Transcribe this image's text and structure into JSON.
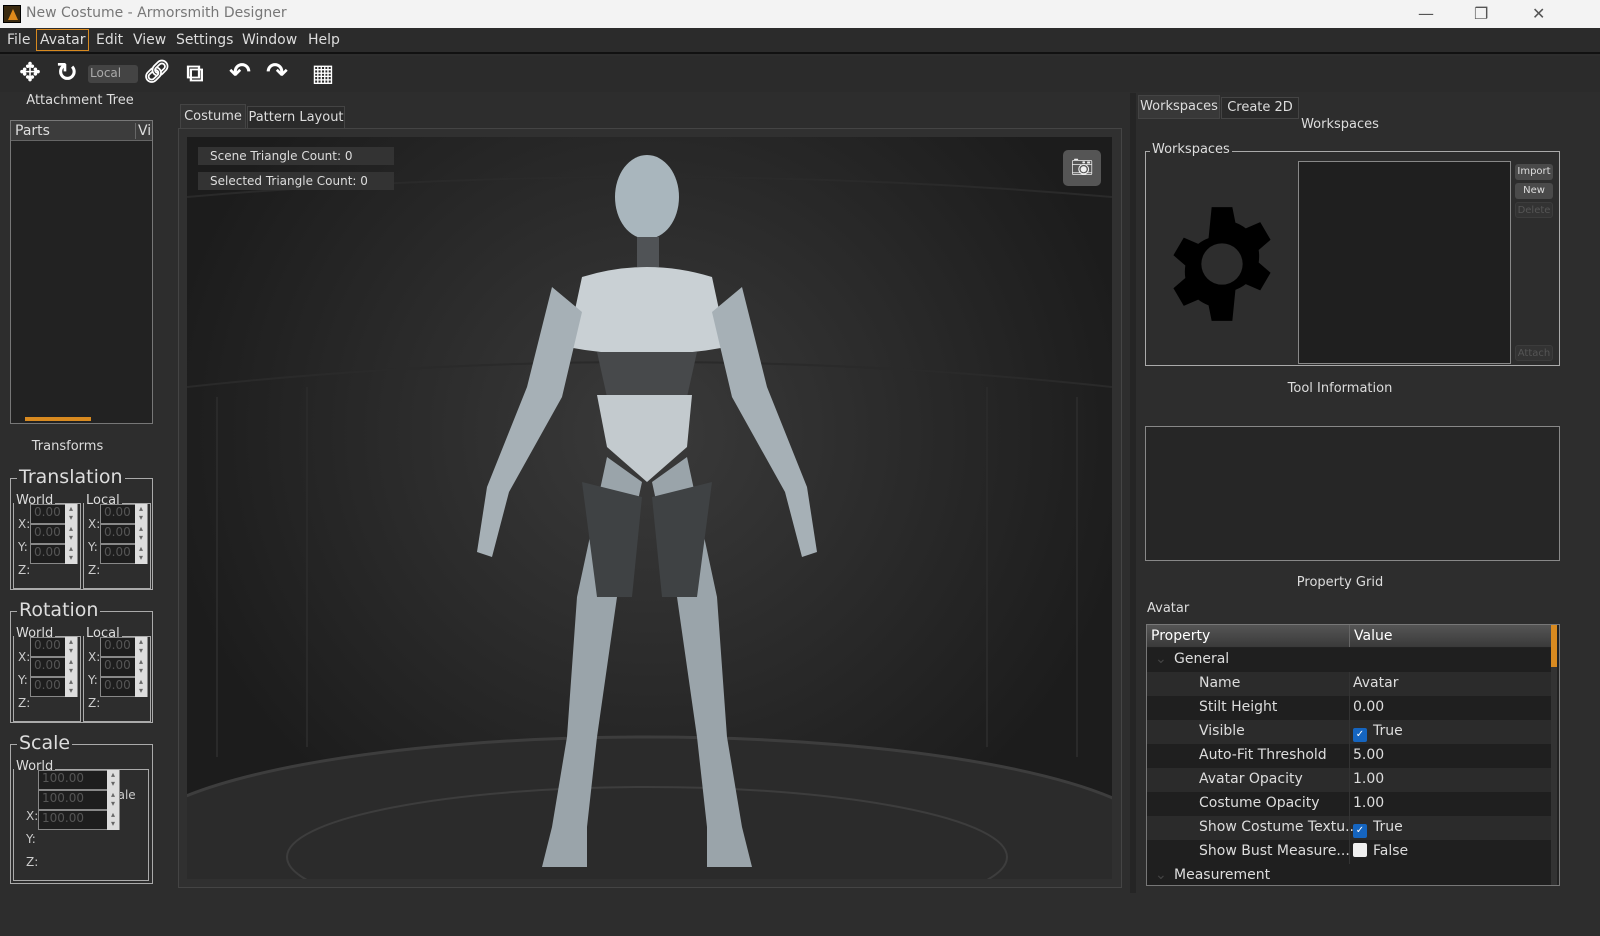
{
  "window": {
    "title": "New Costume - Armorsmith Designer"
  },
  "menu": [
    "File",
    "Avatar",
    "Edit",
    "View",
    "Settings",
    "Window",
    "Help"
  ],
  "toolbar": {
    "space_select": "Local"
  },
  "attachment_tree": {
    "title": "Attachment Tree",
    "columns": [
      "Parts",
      "Vi"
    ]
  },
  "transforms": {
    "title": "Transforms",
    "translation": "Translation",
    "rotation": "Rotation",
    "scale": "Scale",
    "world": "World",
    "local": "Local",
    "x": "X:",
    "y": "Y:",
    "z": "Z:",
    "zero": "0.00",
    "hundred": "100.00",
    "uniform_scale": "Uniform Scale"
  },
  "center_tabs": [
    "Costume",
    "Pattern Layout"
  ],
  "viewport": {
    "scene_tri": "Scene Triangle Count: 0",
    "selected_tri": "Selected Triangle Count: 0"
  },
  "right_tabs": [
    "Workspaces",
    "Create 2D"
  ],
  "workspaces": {
    "title": "Workspaces",
    "group": "Workspaces",
    "buttons": [
      "Import",
      "New",
      "Delete",
      "Attach"
    ]
  },
  "tool_info": {
    "title": "Tool Information"
  },
  "property_grid": {
    "title": "Property Grid",
    "object": "Avatar",
    "col_property": "Property",
    "col_value": "Value",
    "category": "General",
    "category2": "Measurement",
    "rows": [
      {
        "k": "Name",
        "v": "Avatar"
      },
      {
        "k": "Stilt Height",
        "v": "0.00"
      },
      {
        "k": "Visible",
        "v": "True",
        "check": "on"
      },
      {
        "k": "Auto-Fit Threshold",
        "v": "5.00"
      },
      {
        "k": "Avatar Opacity",
        "v": "1.00"
      },
      {
        "k": "Costume Opacity",
        "v": "1.00"
      },
      {
        "k": "Show Costume Textu...",
        "v": "True",
        "check": "on"
      },
      {
        "k": "Show Bust Measure...",
        "v": "False",
        "check": "off"
      }
    ]
  },
  "colors": {
    "accent": "#d88a20",
    "check": "#1565c0"
  }
}
